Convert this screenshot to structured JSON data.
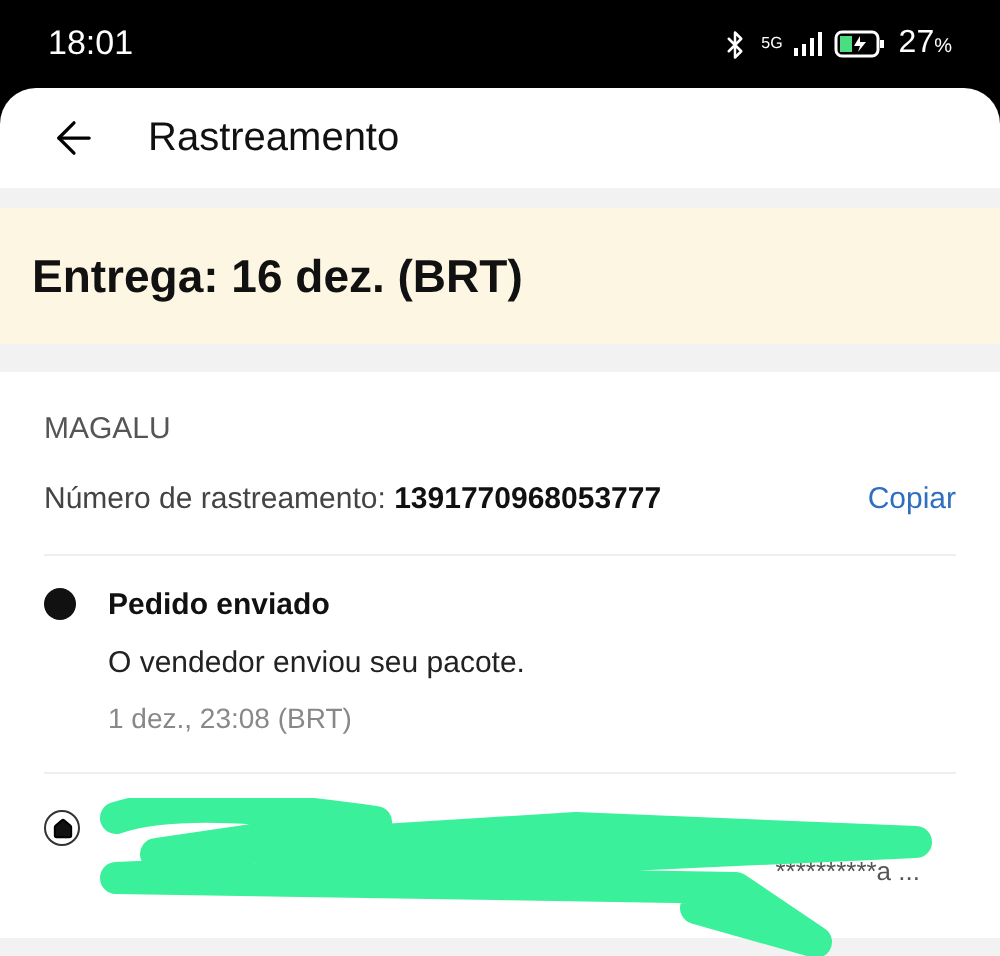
{
  "status_bar": {
    "time": "18:01",
    "battery": "27",
    "battery_unit": "%",
    "network": "5G"
  },
  "header": {
    "title": "Rastreamento"
  },
  "delivery": {
    "label": "Entrega: 16 dez. (BRT)"
  },
  "shipment": {
    "carrier": "MAGALU",
    "tracking_label": "Número de rastreamento:",
    "tracking_number": "1391770968053777",
    "copy_link": "Copiar"
  },
  "events": [
    {
      "title": "Pedido enviado",
      "description": "O vendedor enviou seu pacote.",
      "time": "1 dez., 23:08 (BRT)"
    }
  ],
  "address": {
    "visible_text": "**********a ...",
    "redacted": true
  }
}
